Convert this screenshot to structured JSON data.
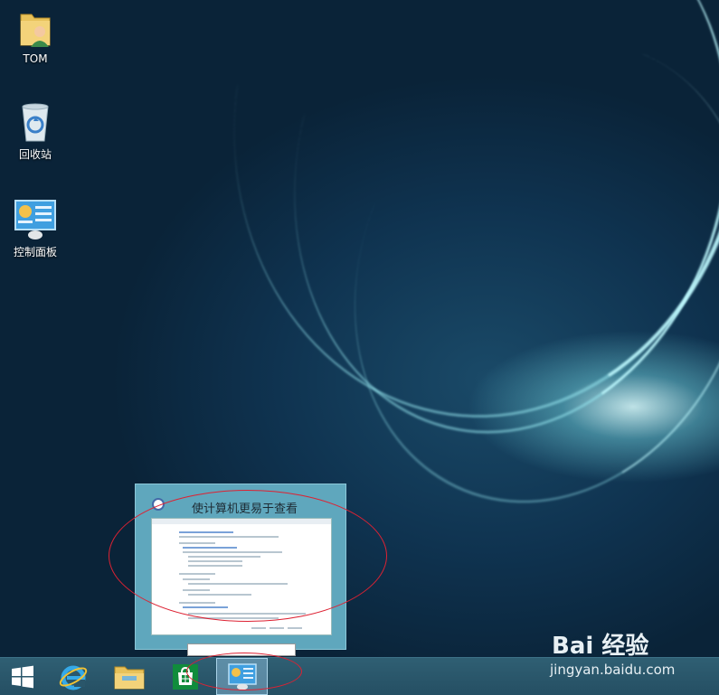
{
  "desktop": {
    "icons": [
      {
        "label": "TOM",
        "icon": "user-folder-icon"
      },
      {
        "label": "回收站",
        "icon": "recycle-bin-icon"
      },
      {
        "label": "控制面板",
        "icon": "control-panel-icon"
      }
    ]
  },
  "preview": {
    "title": "使计算机更易于查看",
    "icon": "ease-of-access-icon"
  },
  "taskbar": {
    "items": [
      {
        "name": "start-button",
        "icon": "windows-logo-icon"
      },
      {
        "name": "internet-explorer",
        "icon": "ie-icon"
      },
      {
        "name": "file-explorer",
        "icon": "folder-icon"
      },
      {
        "name": "store",
        "icon": "store-icon"
      },
      {
        "name": "control-panel",
        "icon": "control-panel-icon",
        "active": true
      }
    ]
  },
  "watermark": {
    "main": "Bai 经验",
    "sub": "jingyan.baidu.com"
  },
  "colors": {
    "taskbar": "#2a566a",
    "annotation": "#dd2233",
    "preview_bg": "#5fa7bd"
  }
}
